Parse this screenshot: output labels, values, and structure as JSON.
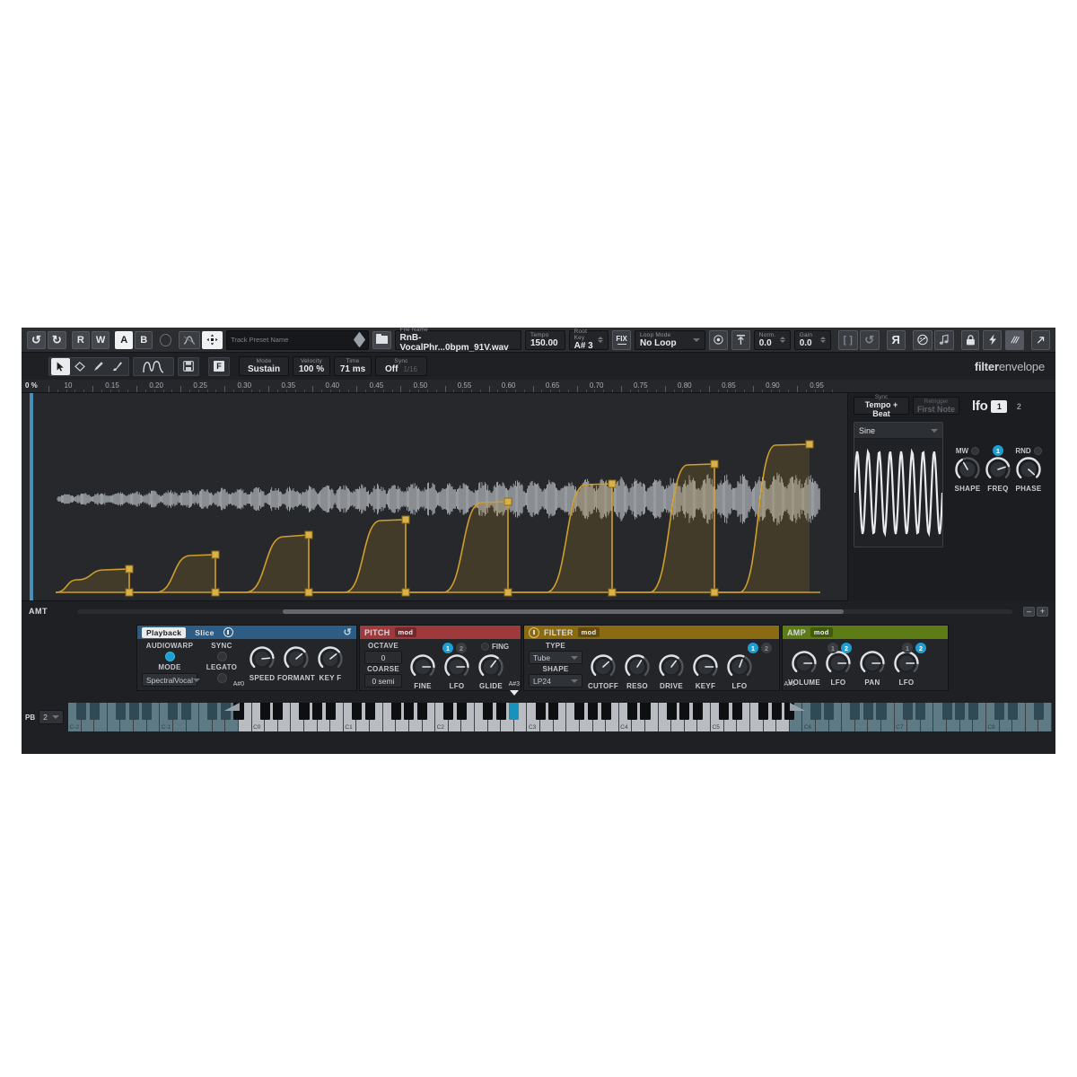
{
  "toolbar": {
    "undo": "↺",
    "redo": "↻",
    "read": "R",
    "write": "W",
    "ab_a": "A",
    "ab_b": "B",
    "preset_label": "Track Preset Name",
    "file_label": "File Name",
    "file_value": "RnB-VocalPhr...0bpm_91V.wav",
    "tempo_label": "Tempo",
    "tempo_value": "150.00",
    "rootkey_label": "Root Key",
    "rootkey_value": "A# 3",
    "fix_label": "FIX",
    "loopmode_label": "Loop Mode",
    "loopmode_value": "No Loop",
    "norm_label": "Norm.",
    "norm_value": "0.0",
    "gain_label": "Gain",
    "gain_value": "0.0",
    "reverse_glyph": "Я"
  },
  "editbar": {
    "mode_label": "Mode",
    "mode_value": "Sustain",
    "velocity_label": "Velocity",
    "velocity_value": "100 %",
    "time_label": "Time",
    "time_value": "71 ms",
    "sync_label": "Sync",
    "sync_value": "Off",
    "sync_sub": "1/16",
    "f_button": "F",
    "logo_bold": "filter",
    "logo_light": "envelope"
  },
  "ruler": {
    "percent": "0 %",
    "ticks": [
      "10",
      "0.15",
      "0.20",
      "0.25",
      "0.30",
      "0.35",
      "0.40",
      "0.45",
      "0.50",
      "0.55",
      "0.60",
      "0.65",
      "0.70",
      "0.75",
      "0.80",
      "0.85",
      "0.90",
      "0.95"
    ]
  },
  "amt": {
    "label": "AMT",
    "zoom_out": "–",
    "zoom_in": "+"
  },
  "lfo": {
    "sync_label": "Sync",
    "sync_value": "Tempo + Beat",
    "retrigger_label": "Retrigger",
    "retrigger_value": "First Note",
    "title": "lfo",
    "tab1": "1",
    "tab2": "2",
    "wave_value": "Sine",
    "mw_label": "MW",
    "rnd_label": "RND",
    "knobs": [
      {
        "label": "SHAPE",
        "angle": -120
      },
      {
        "label": "FREQ",
        "angle": -18
      },
      {
        "label": "PHASE",
        "angle": 42
      }
    ],
    "freq_mod": "1"
  },
  "modules": {
    "playback": {
      "tab_playback": "Playback",
      "tab_slice": "Slice",
      "audiowarp_label": "AUDIOWARP",
      "sync_label": "SYNC",
      "mode_label": "MODE",
      "mode_value": "SpectralVocal",
      "legato_label": "LEGATO",
      "knobs": [
        {
          "label": "SPEED",
          "angle": -5
        },
        {
          "label": "FORMANT",
          "angle": -40
        },
        {
          "label": "KEY F",
          "angle": -38
        }
      ],
      "color": "#2d5d85"
    },
    "pitch": {
      "title": "PITCH",
      "badge": "mod",
      "color": "#9e3a3c",
      "octave_label": "OCTAVE",
      "octave_value": "0",
      "coarse_label": "COARSE",
      "coarse_value": "0 semi",
      "fing_label": "FING",
      "lfo_1": "1",
      "lfo_2": "2",
      "knobs": [
        {
          "label": "FINE",
          "angle": 0
        },
        {
          "label": "LFO",
          "angle": 0
        },
        {
          "label": "GLIDE",
          "angle": -52
        }
      ]
    },
    "filter": {
      "title": "FILTER",
      "badge": "mod",
      "color": "#8a6a13",
      "type_label": "TYPE",
      "type_value": "Tube",
      "shape_label": "SHAPE",
      "shape_value": "LP24",
      "lfo_1": "1",
      "lfo_2": "2",
      "knobs": [
        {
          "label": "CUTOFF",
          "angle": -42
        },
        {
          "label": "RESO",
          "angle": -58
        },
        {
          "label": "DRIVE",
          "angle": -52
        },
        {
          "label": "KEYF",
          "angle": 0
        },
        {
          "label": "LFO",
          "angle": -70
        }
      ]
    },
    "amp": {
      "title": "AMP",
      "badge": "mod",
      "color": "#5e7c16",
      "lfo1_1": "1",
      "lfo1_2": "2",
      "lfo2_1": "1",
      "lfo2_2": "2",
      "knobs": [
        {
          "label": "VOLUME",
          "angle": 0
        },
        {
          "label": "LFO",
          "angle": 0
        },
        {
          "label": "PAN",
          "angle": 0
        },
        {
          "label": "LFO",
          "angle": 0
        }
      ]
    }
  },
  "keyboard": {
    "pb_label": "PB",
    "pb_value": "2",
    "octave_labels": [
      "C-2",
      "C-1",
      "C0",
      "C1",
      "C2",
      "C3",
      "C4",
      "C5",
      "C6",
      "C7",
      "C8"
    ],
    "markers": [
      {
        "name": "A#0",
        "type": "range-start"
      },
      {
        "name": "A#3",
        "type": "root"
      },
      {
        "name": "A#6",
        "type": "range-end"
      }
    ]
  }
}
